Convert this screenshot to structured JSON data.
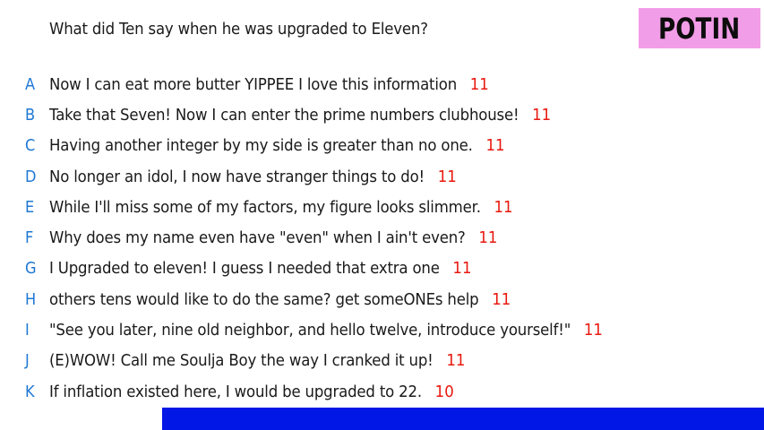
{
  "question": "What did Ten say when he was upgraded to Eleven?",
  "badge": "POTIN",
  "answers": [
    {
      "letter": "A",
      "text": "Now I can eat more butter YIPPEE I love this information",
      "score": "11"
    },
    {
      "letter": "B",
      "text": "Take that Seven! Now I can enter the prime numbers clubhouse!",
      "score": "11"
    },
    {
      "letter": "C",
      "text": "Having another integer by my side is greater than no one.",
      "score": "11"
    },
    {
      "letter": "D",
      "text": "No longer an idol, I now have stranger things to do!",
      "score": "11"
    },
    {
      "letter": "E",
      "text": "While I'll miss some of my factors, my figure looks slimmer.",
      "score": "11"
    },
    {
      "letter": "F",
      "text": "Why does my name even have \"even\" when I ain't even?",
      "score": "11"
    },
    {
      "letter": "G",
      "text": "I Upgraded to eleven! I guess I needed that extra one",
      "score": "11"
    },
    {
      "letter": "H",
      "text": "others tens would like to do the same? get someONEs help",
      "score": "11"
    },
    {
      "letter": "I",
      "text": "\"See you later, nine old neighbor, and hello twelve, introduce yourself!\"",
      "score": "11"
    },
    {
      "letter": "J",
      "text": "(E)WOW! Call me Soulja Boy the way I cranked it up!",
      "score": "11"
    },
    {
      "letter": "K",
      "text": "If inflation existed here, I would be upgraded to 22.",
      "score": "10"
    }
  ],
  "colors": {
    "badge_bg": "#f29de8",
    "letter": "#1f78d4",
    "score": "#e8190f",
    "bar": "#0017e6"
  }
}
